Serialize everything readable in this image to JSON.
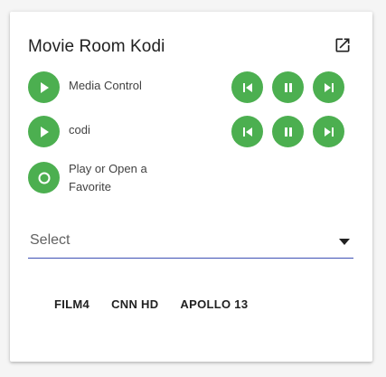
{
  "card": {
    "title": "Movie Room Kodi",
    "rows": [
      {
        "label": "Media Control",
        "play_icon": "play-icon"
      },
      {
        "label": "codi",
        "play_icon": "play-icon"
      },
      {
        "label": "Play or Open a Favorite",
        "play_icon": "circle-icon"
      }
    ],
    "select": {
      "placeholder": "Select"
    },
    "favorites": [
      "FILM4",
      "CNN HD",
      "APOLLO 13"
    ]
  },
  "colors": {
    "accent": "#4caf50",
    "underline": "#3f51b5"
  }
}
